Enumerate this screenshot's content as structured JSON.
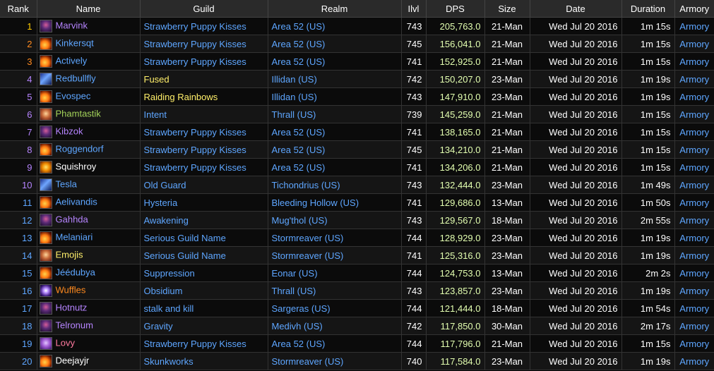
{
  "headers": {
    "rank": "Rank",
    "name": "Name",
    "guild": "Guild",
    "realm": "Realm",
    "ilvl": "Ilvl",
    "dps": "DPS",
    "size": "Size",
    "date": "Date",
    "duration": "Duration",
    "armory": "Armory"
  },
  "colors": {
    "gold": "#ffcc00",
    "orange": "#ff8a1f",
    "blue": "#5ea6ff",
    "purple": "#b684ff",
    "green": "#a4d35a",
    "white": "#ffffff",
    "pink": "#ff7a9f",
    "yellow": "#ffef6a",
    "link": "#5ea6ff",
    "dps": "#e3ffb0"
  },
  "rows": [
    {
      "rank": "1",
      "name": "Marvink",
      "icon": "demon-icon",
      "icon_class": "demon",
      "rank_color": "#ffcc00",
      "name_color": "#b684ff",
      "guild": "Strawberry Puppy Kisses",
      "guild_color": "#5ea6ff",
      "realm": "Area 52 (US)",
      "ilvl": "743",
      "dps": "205,763.0",
      "size": "21-Man",
      "date": "Wed Jul 20 2016",
      "duration": "1m 15s",
      "armory": "Armory"
    },
    {
      "rank": "2",
      "name": "Kinkersqt",
      "icon": "flame-icon",
      "icon_class": "flame",
      "rank_color": "#ff8a1f",
      "name_color": "#5ea6ff",
      "guild": "Strawberry Puppy Kisses",
      "guild_color": "#5ea6ff",
      "realm": "Area 52 (US)",
      "ilvl": "745",
      "dps": "156,041.0",
      "size": "21-Man",
      "date": "Wed Jul 20 2016",
      "duration": "1m 15s",
      "armory": "Armory"
    },
    {
      "rank": "3",
      "name": "Actively",
      "icon": "flame-icon",
      "icon_class": "flame",
      "rank_color": "#ff8a1f",
      "name_color": "#5ea6ff",
      "guild": "Strawberry Puppy Kisses",
      "guild_color": "#5ea6ff",
      "realm": "Area 52 (US)",
      "ilvl": "741",
      "dps": "152,925.0",
      "size": "21-Man",
      "date": "Wed Jul 20 2016",
      "duration": "1m 15s",
      "armory": "Armory"
    },
    {
      "rank": "4",
      "name": "Redbullfly",
      "icon": "arrow-icon",
      "icon_class": "arrow",
      "rank_color": "#b684ff",
      "name_color": "#5ea6ff",
      "guild": "Fused",
      "guild_color": "#ffef6a",
      "realm": "Illidan (US)",
      "ilvl": "742",
      "dps": "150,207.0",
      "size": "23-Man",
      "date": "Wed Jul 20 2016",
      "duration": "1m 19s",
      "armory": "Armory"
    },
    {
      "rank": "5",
      "name": "Evospec",
      "icon": "flame-icon",
      "icon_class": "flame",
      "rank_color": "#b684ff",
      "name_color": "#5ea6ff",
      "guild": "Raiding Rainbows",
      "guild_color": "#ffef6a",
      "realm": "Illidan (US)",
      "ilvl": "743",
      "dps": "147,910.0",
      "size": "23-Man",
      "date": "Wed Jul 20 2016",
      "duration": "1m 19s",
      "armory": "Armory"
    },
    {
      "rank": "6",
      "name": "Phamtastik",
      "icon": "face-icon",
      "icon_class": "face",
      "rank_color": "#b684ff",
      "name_color": "#a4d35a",
      "guild": "Intent",
      "guild_color": "#5ea6ff",
      "realm": "Thrall (US)",
      "ilvl": "739",
      "dps": "145,259.0",
      "size": "21-Man",
      "date": "Wed Jul 20 2016",
      "duration": "1m 15s",
      "armory": "Armory"
    },
    {
      "rank": "7",
      "name": "Kibzok",
      "icon": "demon-icon",
      "icon_class": "demon",
      "rank_color": "#b684ff",
      "name_color": "#b684ff",
      "guild": "Strawberry Puppy Kisses",
      "guild_color": "#5ea6ff",
      "realm": "Area 52 (US)",
      "ilvl": "741",
      "dps": "138,165.0",
      "size": "21-Man",
      "date": "Wed Jul 20 2016",
      "duration": "1m 15s",
      "armory": "Armory"
    },
    {
      "rank": "8",
      "name": "Roggendorf",
      "icon": "flame-icon",
      "icon_class": "flame",
      "rank_color": "#b684ff",
      "name_color": "#5ea6ff",
      "guild": "Strawberry Puppy Kisses",
      "guild_color": "#5ea6ff",
      "realm": "Area 52 (US)",
      "ilvl": "745",
      "dps": "134,210.0",
      "size": "21-Man",
      "date": "Wed Jul 20 2016",
      "duration": "1m 15s",
      "armory": "Armory"
    },
    {
      "rank": "9",
      "name": "Squishroy",
      "icon": "orb-icon",
      "icon_class": "orb",
      "rank_color": "#b684ff",
      "name_color": "#ffffff",
      "guild": "Strawberry Puppy Kisses",
      "guild_color": "#5ea6ff",
      "realm": "Area 52 (US)",
      "ilvl": "741",
      "dps": "134,206.0",
      "size": "21-Man",
      "date": "Wed Jul 20 2016",
      "duration": "1m 15s",
      "armory": "Armory"
    },
    {
      "rank": "10",
      "name": "Tesla",
      "icon": "arrow-icon",
      "icon_class": "arrow",
      "rank_color": "#b684ff",
      "name_color": "#5ea6ff",
      "guild": "Old Guard",
      "guild_color": "#5ea6ff",
      "realm": "Tichondrius (US)",
      "ilvl": "743",
      "dps": "132,444.0",
      "size": "23-Man",
      "date": "Wed Jul 20 2016",
      "duration": "1m 49s",
      "armory": "Armory"
    },
    {
      "rank": "11",
      "name": "Aelivandis",
      "icon": "flame-icon",
      "icon_class": "flame",
      "rank_color": "#5ea6ff",
      "name_color": "#5ea6ff",
      "guild": "Hysteria",
      "guild_color": "#5ea6ff",
      "realm": "Bleeding Hollow (US)",
      "ilvl": "741",
      "dps": "129,686.0",
      "size": "13-Man",
      "date": "Wed Jul 20 2016",
      "duration": "1m 50s",
      "armory": "Armory"
    },
    {
      "rank": "12",
      "name": "Gahhda",
      "icon": "demon-icon",
      "icon_class": "demon",
      "rank_color": "#5ea6ff",
      "name_color": "#b684ff",
      "guild": "Awakening",
      "guild_color": "#5ea6ff",
      "realm": "Mug'thol (US)",
      "ilvl": "743",
      "dps": "129,567.0",
      "size": "18-Man",
      "date": "Wed Jul 20 2016",
      "duration": "2m 55s",
      "armory": "Armory"
    },
    {
      "rank": "13",
      "name": "Melaniari",
      "icon": "flame-icon",
      "icon_class": "flame",
      "rank_color": "#5ea6ff",
      "name_color": "#5ea6ff",
      "guild": "Serious Guild Name",
      "guild_color": "#5ea6ff",
      "realm": "Stormreaver (US)",
      "ilvl": "744",
      "dps": "128,929.0",
      "size": "23-Man",
      "date": "Wed Jul 20 2016",
      "duration": "1m 19s",
      "armory": "Armory"
    },
    {
      "rank": "14",
      "name": "Emojis",
      "icon": "face-icon",
      "icon_class": "face",
      "rank_color": "#5ea6ff",
      "name_color": "#ffef6a",
      "guild": "Serious Guild Name",
      "guild_color": "#5ea6ff",
      "realm": "Stormreaver (US)",
      "ilvl": "741",
      "dps": "125,316.0",
      "size": "23-Man",
      "date": "Wed Jul 20 2016",
      "duration": "1m 19s",
      "armory": "Armory"
    },
    {
      "rank": "15",
      "name": "Jéédubya",
      "icon": "flame-icon",
      "icon_class": "flame",
      "rank_color": "#5ea6ff",
      "name_color": "#5ea6ff",
      "guild": "Suppression",
      "guild_color": "#5ea6ff",
      "realm": "Eonar (US)",
      "ilvl": "744",
      "dps": "124,753.0",
      "size": "13-Man",
      "date": "Wed Jul 20 2016",
      "duration": "2m 2s",
      "armory": "Armory"
    },
    {
      "rank": "16",
      "name": "Wuffles",
      "icon": "spark-icon",
      "icon_class": "spark",
      "rank_color": "#5ea6ff",
      "name_color": "#ff8a1f",
      "guild": "Obsidium",
      "guild_color": "#5ea6ff",
      "realm": "Thrall (US)",
      "ilvl": "743",
      "dps": "123,857.0",
      "size": "23-Man",
      "date": "Wed Jul 20 2016",
      "duration": "1m 19s",
      "armory": "Armory"
    },
    {
      "rank": "17",
      "name": "Hotnutz",
      "icon": "demon-icon",
      "icon_class": "demon",
      "rank_color": "#5ea6ff",
      "name_color": "#b684ff",
      "guild": "stalk and kill",
      "guild_color": "#5ea6ff",
      "realm": "Sargeras (US)",
      "ilvl": "744",
      "dps": "121,444.0",
      "size": "18-Man",
      "date": "Wed Jul 20 2016",
      "duration": "1m 54s",
      "armory": "Armory"
    },
    {
      "rank": "18",
      "name": "Telronum",
      "icon": "demon-icon",
      "icon_class": "demon",
      "rank_color": "#5ea6ff",
      "name_color": "#b684ff",
      "guild": "Gravity",
      "guild_color": "#5ea6ff",
      "realm": "Medivh (US)",
      "ilvl": "742",
      "dps": "117,850.0",
      "size": "30-Man",
      "date": "Wed Jul 20 2016",
      "duration": "2m 17s",
      "armory": "Armory"
    },
    {
      "rank": "19",
      "name": "Lovy",
      "icon": "mask-icon",
      "icon_class": "mask",
      "rank_color": "#5ea6ff",
      "name_color": "#ff7a9f",
      "guild": "Strawberry Puppy Kisses",
      "guild_color": "#5ea6ff",
      "realm": "Area 52 (US)",
      "ilvl": "744",
      "dps": "117,796.0",
      "size": "21-Man",
      "date": "Wed Jul 20 2016",
      "duration": "1m 15s",
      "armory": "Armory"
    },
    {
      "rank": "20",
      "name": "Deejayjr",
      "icon": "flame-icon",
      "icon_class": "flame",
      "rank_color": "#5ea6ff",
      "name_color": "#ffffff",
      "guild": "Skunkworks",
      "guild_color": "#5ea6ff",
      "realm": "Stormreaver (US)",
      "ilvl": "740",
      "dps": "117,584.0",
      "size": "23-Man",
      "date": "Wed Jul 20 2016",
      "duration": "1m 19s",
      "armory": "Armory"
    }
  ]
}
